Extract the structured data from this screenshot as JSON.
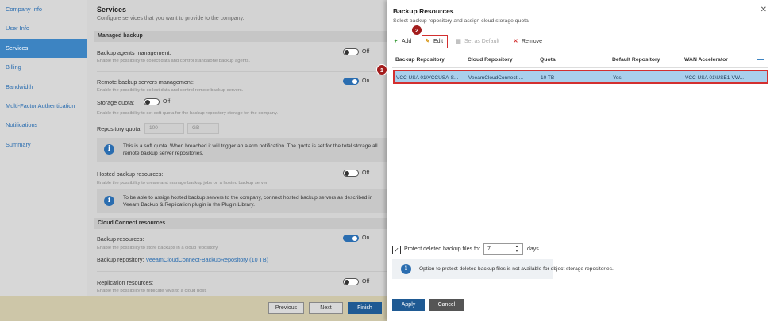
{
  "nav": {
    "items": [
      {
        "label": "Company Info"
      },
      {
        "label": "User Info"
      },
      {
        "label": "Services"
      },
      {
        "label": "Billing"
      },
      {
        "label": "Bandwidth"
      },
      {
        "label": "Multi-Factor Authentication"
      },
      {
        "label": "Notifications"
      },
      {
        "label": "Summary"
      }
    ]
  },
  "services": {
    "title": "Services",
    "subtitle": "Configure services that you want to provide to the company.",
    "managed_backup": "Managed backup",
    "agents_label": "Backup agents management:",
    "agents_desc": "Enable the possibility to collect data and control standalone backup agents.",
    "agents_state": "Off",
    "remote_label": "Remote backup servers management:",
    "remote_desc": "Enable the possibility to collect data and control remote backup servers.",
    "remote_state": "On",
    "quota_label": "Storage quota:",
    "quota_state": "Off",
    "quota_desc": "Enable the possibility to set soft quota for the backup repository storage for the company.",
    "repo_quota_label": "Repository quota:",
    "repo_quota_value": "100",
    "repo_quota_unit": "GB",
    "quota_info": "This is a soft quota. When breached it will trigger an alarm notification. The quota is set for the total storage all remote backup server repositories.",
    "hosted_label": "Hosted backup resources:",
    "hosted_desc": "Enable the possibility to create and manage backup jobs on a hosted backup server.",
    "hosted_state": "Off",
    "hosted_info": "To be able to assign hosted backup servers to the company, connect hosted backup servers as described in Veeam Backup & Replication plugin in the Plugin Library.",
    "cloud_connect": "Cloud Connect resources",
    "backup_res_label": "Backup resources:",
    "backup_res_desc": "Enable the possibility to store backups in a cloud repository.",
    "backup_res_state": "On",
    "backup_repo_label": "Backup repository:",
    "backup_repo_value": "VeeamCloudConnect-BackupRepository (10 TB)",
    "replication_label": "Replication resources:",
    "replication_desc": "Enable the possibility to replicate VMs to a cloud host.",
    "replication_state": "Off"
  },
  "footer": {
    "previous": "Previous",
    "next": "Next",
    "finish": "Finish"
  },
  "panel": {
    "title": "Backup Resources",
    "subtitle": "Select backup repository and assign cloud storage quota.",
    "toolbar": {
      "add": "Add",
      "edit": "Edit",
      "set_default": "Set as Default",
      "remove": "Remove"
    },
    "columns": [
      "Backup Repository",
      "Cloud Repository",
      "Quota",
      "Default Repository",
      "WAN Accelerator"
    ],
    "row": [
      "VCC USA 01\\VCCUSA-S...",
      "VeeamCloudConnect-...",
      "10 TB",
      "Yes",
      "VCC USA 01\\USE1-VW..."
    ],
    "protect_label": "Protect deleted backup files for",
    "protect_value": "7",
    "protect_unit": "days",
    "info": "Option to protect deleted backup files is not available for object storage repositories.",
    "apply": "Apply",
    "cancel": "Cancel"
  },
  "badges": {
    "one": "1",
    "two": "2"
  },
  "colors": {
    "accent": "#2a6db0",
    "highlight_border": "#d32f2f",
    "badge": "#a31d1d"
  }
}
